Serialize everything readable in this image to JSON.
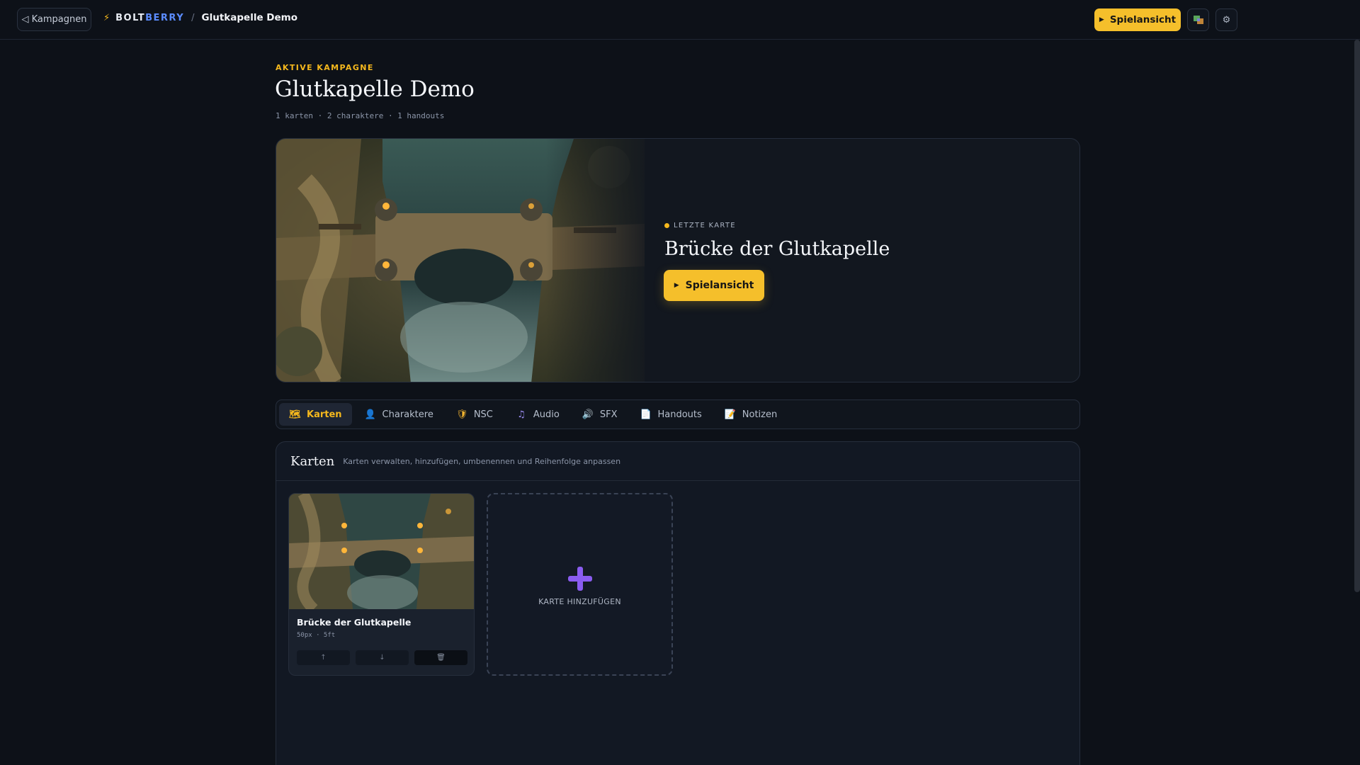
{
  "topbar": {
    "back_label": "◁ Kampagnen",
    "brand_first": "BOLT",
    "brand_second": "BERRY",
    "separator": "/",
    "crumb": "Glutkapelle Demo",
    "play_label": "Spielansicht"
  },
  "header": {
    "kicker": "AKTIVE KAMPAGNE",
    "title": "Glutkapelle Demo",
    "counts": "1 karten · 2 charaktere · 1 handouts"
  },
  "hero": {
    "label": "LETZTE KARTE",
    "map_title": "Brücke der Glutkapelle",
    "play_label": "Spielansicht"
  },
  "tabs": [
    {
      "label": "Karten",
      "icon": "map-icon",
      "glyph": "🗺"
    },
    {
      "label": "Charaktere",
      "icon": "person-icon",
      "glyph": "👤"
    },
    {
      "label": "NSC",
      "icon": "mask-icon",
      "glyph": "🛡"
    },
    {
      "label": "Audio",
      "icon": "music-icon",
      "glyph": "♫"
    },
    {
      "label": "SFX",
      "icon": "speaker-icon",
      "glyph": "🔊"
    },
    {
      "label": "Handouts",
      "icon": "document-icon",
      "glyph": "📄"
    },
    {
      "label": "Notizen",
      "icon": "notes-icon",
      "glyph": "📝"
    }
  ],
  "panel": {
    "title": "Karten",
    "subtitle": "Karten verwalten, hinzufügen, umbenennen und Reihenfolge anpassen",
    "maps": [
      {
        "name": "Brücke der Glutkapelle",
        "meta": "50px · 5ft",
        "up": "↑",
        "down": "↓",
        "delete": "🗑"
      }
    ],
    "add_label": "KARTE HINZUFÜGEN"
  },
  "colors": {
    "accent": "#f5bf2b",
    "brand_blue": "#5b8cff",
    "background": "#0d1118",
    "plus": "#8a5cf0"
  }
}
